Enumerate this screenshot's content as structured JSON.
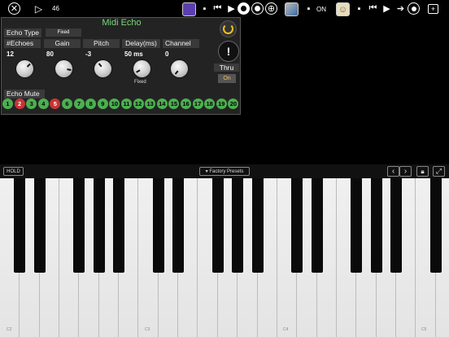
{
  "top_bar": {
    "close_icon": "close-icon",
    "play_icon": "play-icon",
    "position": "46",
    "status_text": "ON"
  },
  "plugin": {
    "title": "Midi Echo",
    "echo_type": {
      "label": "Echo Type",
      "value": "Fixed"
    },
    "params": [
      {
        "label": "#Echoes",
        "value": "12"
      },
      {
        "label": "Gain",
        "value": "80"
      },
      {
        "label": "Pitch",
        "value": "-3"
      },
      {
        "label": "Delay(ms)",
        "value": "50 ms",
        "sub": "Fixed"
      },
      {
        "label": "Channel",
        "value": "0"
      }
    ],
    "thru": {
      "label": "Thru",
      "value": "On"
    },
    "info_glyph": "!",
    "echo_mute": {
      "label": "Echo Mute",
      "buttons": [
        {
          "n": "1",
          "state": "on"
        },
        {
          "n": "2",
          "state": "off"
        },
        {
          "n": "3",
          "state": "on"
        },
        {
          "n": "4",
          "state": "on"
        },
        {
          "n": "5",
          "state": "off"
        },
        {
          "n": "6",
          "state": "on"
        },
        {
          "n": "7",
          "state": "on"
        },
        {
          "n": "8",
          "state": "on"
        },
        {
          "n": "9",
          "state": "on"
        },
        {
          "n": "10",
          "state": "on"
        },
        {
          "n": "11",
          "state": "on"
        },
        {
          "n": "12",
          "state": "on"
        },
        {
          "n": "13",
          "state": "on"
        },
        {
          "n": "14",
          "state": "on"
        },
        {
          "n": "15",
          "state": "on"
        },
        {
          "n": "16",
          "state": "on"
        },
        {
          "n": "17",
          "state": "on"
        },
        {
          "n": "18",
          "state": "on"
        },
        {
          "n": "19",
          "state": "on"
        },
        {
          "n": "20",
          "state": "on"
        }
      ]
    }
  },
  "keyboard_bar": {
    "hold_label": "HOLD",
    "presets_label": "▾ Factory Presets"
  },
  "keyboard": {
    "octave_labels": [
      "C2",
      "C3",
      "C4",
      "C5"
    ]
  },
  "colors": {
    "mute_on": "#4caf50",
    "mute_off": "#c83434",
    "power": "#f0c020",
    "title": "#78d878",
    "thru_on": "#e8c060"
  }
}
